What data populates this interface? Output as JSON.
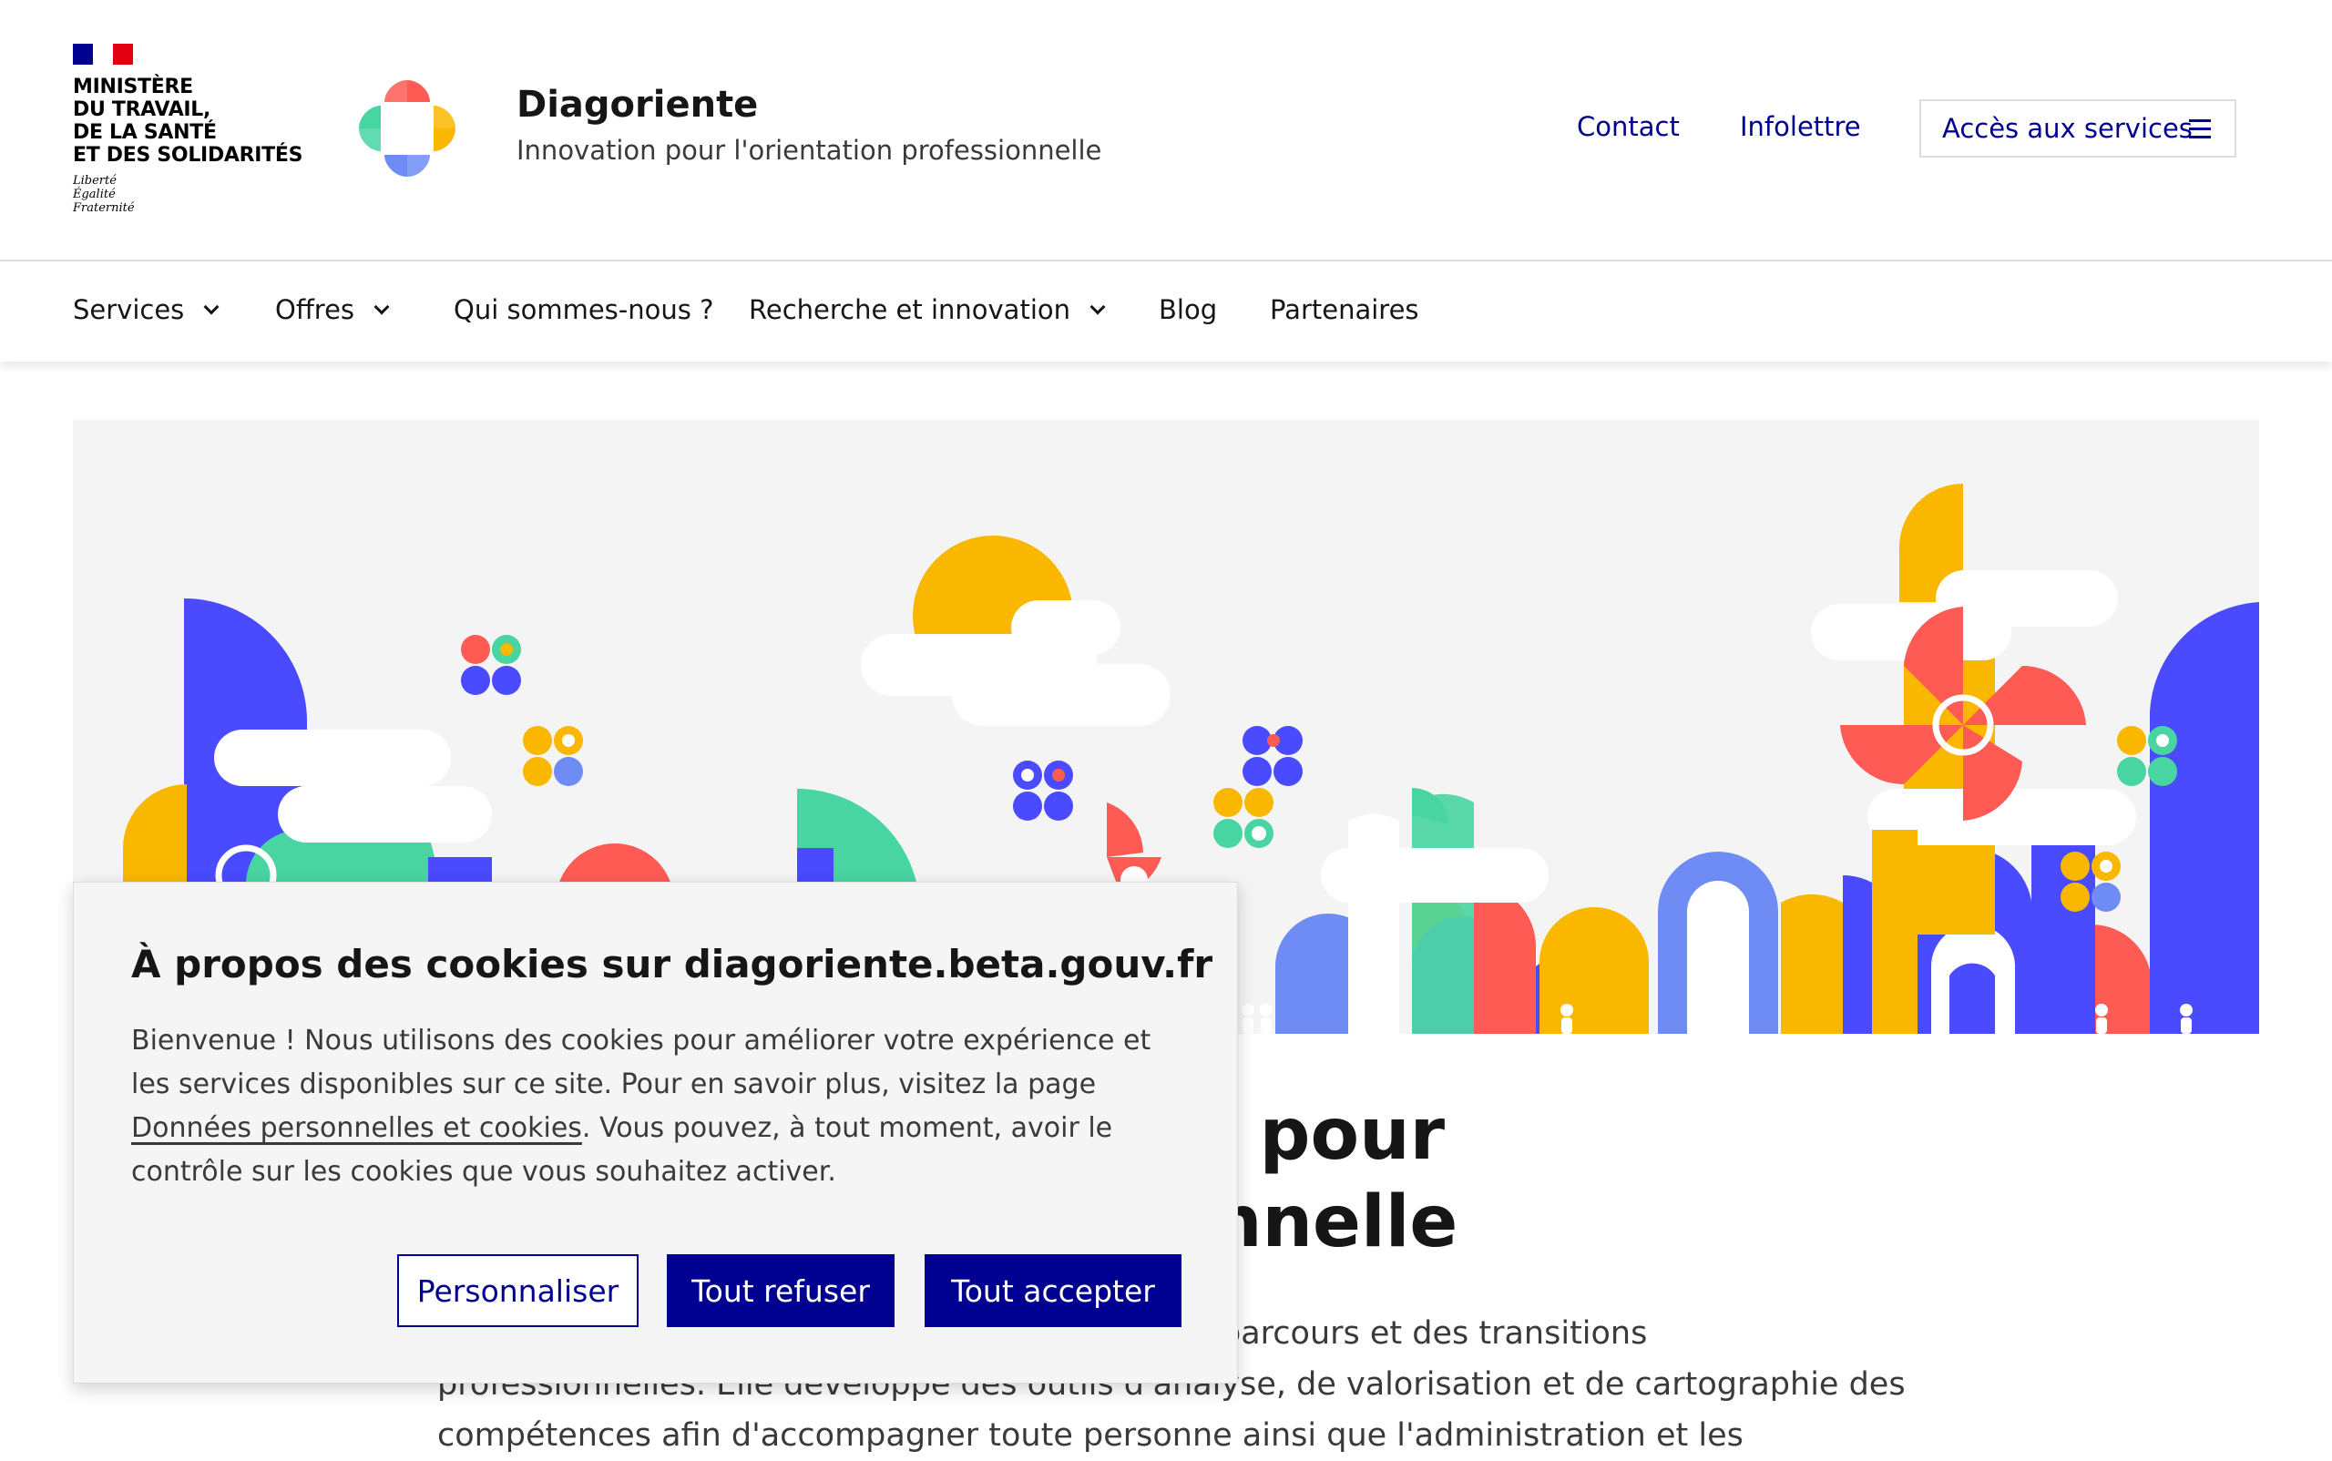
{
  "ministry": {
    "name_lines": [
      "Ministère",
      "du travail,",
      "de la santé",
      "et des solidarités"
    ],
    "devise_lines": [
      "Liberté",
      "Égalité",
      "Fraternité"
    ]
  },
  "brand": {
    "title": "Diagoriente",
    "subtitle": "Innovation pour l'orientation professionnelle"
  },
  "header_links": {
    "contact": "Contact",
    "infolettre": "Infolettre",
    "acces": "Accès aux services"
  },
  "nav": {
    "items": [
      {
        "label": "Services",
        "dropdown": true
      },
      {
        "label": "Offres",
        "dropdown": true
      },
      {
        "label": "Qui sommes-nous ?",
        "dropdown": false
      },
      {
        "label": "Recherche et innovation",
        "dropdown": true
      },
      {
        "label": "Blog",
        "dropdown": false
      },
      {
        "label": "Partenaires",
        "dropdown": false
      }
    ]
  },
  "main": {
    "title_visible_fragments": [
      "n pour",
      "nnelle"
    ],
    "text_visible_fragments": [
      "parcours et des transitions",
      "professionnelles. Elle développe des outils d'analyse, de valorisation et de cartographie des",
      "compétences afin d'accompagner toute personne ainsi que l'administration et les"
    ]
  },
  "cookie": {
    "title": "À propos des cookies sur diagoriente.beta.gouv.fr",
    "text_before_link": "Bienvenue ! Nous utilisons des cookies pour améliorer votre expérience et les services disponibles sur ce site. Pour en savoir plus, visitez la page ",
    "link": "Données personnelles et cookies",
    "text_after_link": ".  Vous pouvez, à tout moment, avoir le contrôle sur les cookies que vous souhaitez activer.",
    "btn_personnaliser": "Personnaliser",
    "btn_refuser": "Tout refuser",
    "btn_accepter": "Tout accepter"
  },
  "colors": {
    "primary": "#000091",
    "blue": "#4a4aff",
    "light_blue": "#6e8cf3",
    "yellow": "#f9b700",
    "red": "#ff5b55",
    "green": "#48d5a2",
    "hero_bg": "#f4f4f4"
  }
}
